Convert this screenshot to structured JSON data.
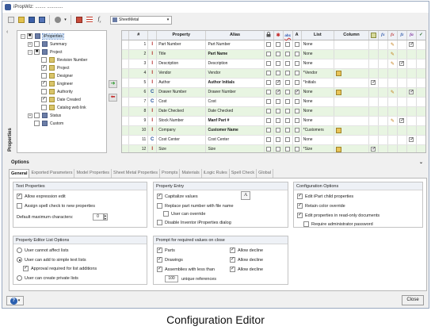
{
  "window": {
    "title": "iPropWiz: ........ ............"
  },
  "toolbar": {
    "style_select": "SheetMetal",
    "icons": [
      "new-icon",
      "open-icon",
      "save-icon",
      "save-as-icon",
      "tools-icon",
      "wizard-icon",
      "list-icon",
      "formula-icon"
    ]
  },
  "side_label": "Properties",
  "tree": {
    "nodes": [
      {
        "label": "iProperties",
        "level": 0,
        "expander": "−",
        "check": "■",
        "folder": false,
        "selected": true
      },
      {
        "label": "Summary",
        "level": 1,
        "expander": "+",
        "check": "",
        "folder": false
      },
      {
        "label": "Project",
        "level": 1,
        "expander": "−",
        "check": "■",
        "folder": false
      },
      {
        "label": "Revision Number",
        "level": 2,
        "expander": "",
        "check": "",
        "folder": true
      },
      {
        "label": "Project",
        "level": 2,
        "expander": "",
        "check": "✓",
        "folder": true
      },
      {
        "label": "Designer",
        "level": 2,
        "expander": "",
        "check": "",
        "folder": true
      },
      {
        "label": "Engineer",
        "level": 2,
        "expander": "",
        "check": "✓",
        "folder": true
      },
      {
        "label": "Authority",
        "level": 2,
        "expander": "",
        "check": "",
        "folder": true
      },
      {
        "label": "Date Created",
        "level": 2,
        "expander": "",
        "check": "✓",
        "folder": true
      },
      {
        "label": "Catalog web link",
        "level": 2,
        "expander": "",
        "check": "",
        "folder": true
      },
      {
        "label": "Status",
        "level": 1,
        "expander": "+",
        "check": "",
        "folder": false
      },
      {
        "label": "Custom",
        "level": 1,
        "expander": "",
        "check": "",
        "folder": false
      }
    ]
  },
  "grid": {
    "columns": [
      "#",
      "",
      "Property",
      "Alias",
      "",
      "",
      "abc",
      "A",
      "List",
      "Column",
      "",
      "",
      "",
      "",
      "",
      ""
    ],
    "rows": [
      {
        "n": "1",
        "type": "I",
        "prop": "Part Number",
        "alias": "Part Number",
        "aliasBold": false,
        "c1": "",
        "c2": "",
        "c3": "",
        "c4": "",
        "list": "None",
        "colI": "",
        "f1": "",
        "f2": "",
        "f3": "pen",
        "f4": "",
        "f5": "✓"
      },
      {
        "n": "2",
        "type": "I",
        "prop": "Title",
        "alias": "Part Name",
        "aliasBold": true,
        "c1": "",
        "c2": "",
        "c3": "",
        "c4": "",
        "list": "None",
        "colI": "",
        "f1": "",
        "f2": "",
        "f3": "pen",
        "f4": "",
        "f5": ""
      },
      {
        "n": "3",
        "type": "I",
        "prop": "Description",
        "alias": "Description",
        "aliasBold": false,
        "c1": "",
        "c2": "",
        "c3": "",
        "c4": "",
        "list": "None",
        "colI": "",
        "f1": "",
        "f2": "",
        "f3": "pen",
        "f4": "✓",
        "f5": ""
      },
      {
        "n": "4",
        "type": "I",
        "prop": "Vendor",
        "alias": "Vendor",
        "aliasBold": false,
        "c1": "",
        "c2": "",
        "c3": "",
        "c4": "",
        "list": "*Vendor",
        "colI": "tbl",
        "f1": "",
        "f2": "",
        "f3": "",
        "f4": "",
        "f5": ""
      },
      {
        "n": "5",
        "type": "I",
        "prop": "Author",
        "alias": "Author Initials",
        "aliasBold": true,
        "c1": "",
        "c2": "✓",
        "c3": "",
        "c4": "",
        "list": "*Initials",
        "colI": "",
        "f1": "✓",
        "f2": "",
        "f3": "",
        "f4": "",
        "f5": ""
      },
      {
        "n": "6",
        "type": "C",
        "prop": "Drawer Number",
        "alias": "Drawer Number",
        "aliasBold": false,
        "c1": "",
        "c2": "✓",
        "c3": "",
        "c4": "✓",
        "list": "None",
        "colI": "tbl",
        "f1": "",
        "f2": "",
        "f3": "pen",
        "f4": "",
        "f5": "✓"
      },
      {
        "n": "7",
        "type": "C",
        "prop": "Cost",
        "alias": "Cost",
        "aliasBold": false,
        "c1": "",
        "c2": "",
        "c3": "",
        "c4": "",
        "list": "None",
        "colI": "",
        "f1": "",
        "f2": "",
        "f3": "",
        "f4": "",
        "f5": ""
      },
      {
        "n": "8",
        "type": "I",
        "prop": "Date Checked",
        "alias": "Date Checked",
        "aliasBold": false,
        "c1": "",
        "c2": "",
        "c3": "",
        "c4": "",
        "list": "None",
        "colI": "",
        "f1": "",
        "f2": "",
        "f3": "",
        "f4": "",
        "f5": ""
      },
      {
        "n": "9",
        "type": "I",
        "prop": "Stock Number",
        "alias": "Manf Part #",
        "aliasBold": true,
        "c1": "",
        "c2": "",
        "c3": "",
        "c4": "",
        "list": "None",
        "colI": "",
        "f1": "",
        "f2": "",
        "f3": "pen",
        "f4": "✓",
        "f5": ""
      },
      {
        "n": "10",
        "type": "I",
        "prop": "Company",
        "alias": "Customer Name",
        "aliasBold": true,
        "c1": "",
        "c2": "",
        "c3": "",
        "c4": "",
        "list": "*Customers",
        "colI": "tbl",
        "f1": "",
        "f2": "",
        "f3": "",
        "f4": "",
        "f5": ""
      },
      {
        "n": "11",
        "type": "C",
        "prop": "Cost Center",
        "alias": "Cost Center",
        "aliasBold": false,
        "c1": "",
        "c2": "",
        "c3": "",
        "c4": "",
        "list": "None",
        "colI": "",
        "f1": "",
        "f2": "",
        "f3": "",
        "f4": "",
        "f5": "✓"
      },
      {
        "n": "12",
        "type": "I",
        "prop": "Size",
        "alias": "Size",
        "aliasBold": false,
        "c1": "",
        "c2": "",
        "c3": "",
        "c4": "",
        "list": "*Size",
        "colI": "tbl",
        "f1": "✓",
        "f2": "",
        "f3": "",
        "f4": "",
        "f5": ""
      }
    ]
  },
  "options": {
    "header": "Options",
    "tabs": [
      "General",
      "Exported Parameters",
      "Model Properties",
      "Sheet Metal Properties",
      "Prompts",
      "Materials",
      "iLogic Rules",
      "Spell Check",
      "Global"
    ],
    "text_properties": {
      "title": "Text Properties",
      "allow_expression": "Allow expression edit",
      "spell_check": "Assign spell check to new properties",
      "max_chars_label": "Default maximum characters:",
      "max_chars_value": "0"
    },
    "property_entry": {
      "title": "Property Entry",
      "capitalize": "Capitalize values",
      "replace_part": "Replace part number with file name",
      "user_override": "User can override",
      "disable_dialog": "Disable Inventor iProperties dialog",
      "font_button": "A"
    },
    "configuration": {
      "title": "Configuration Options",
      "edit_child": "Edit iPart child properties",
      "retain_color": "Retain color override",
      "edit_readonly": "Edit properties in read-only documents",
      "require_admin": "Require administrator password"
    },
    "list_options": {
      "title": "Property Editor List Options",
      "cannot_affect": "User cannot affect lists",
      "add_simple": "User can add to simple text lists",
      "approval": "Approval required for list additions",
      "private_lists": "User can create private lists"
    },
    "prompt_close": {
      "title": "Prompt for required values on close",
      "parts": "Parts",
      "drawings": "Drawings",
      "assemblies": "Assemblies with less than",
      "allow_decline_1": "Allow decline",
      "allow_decline_2": "Allow decline",
      "allow_decline_3": "Allow decline",
      "unique_value": "100",
      "unique_label": "unique references"
    }
  },
  "footer": {
    "close": "Close"
  },
  "caption": "Configuration Editor"
}
